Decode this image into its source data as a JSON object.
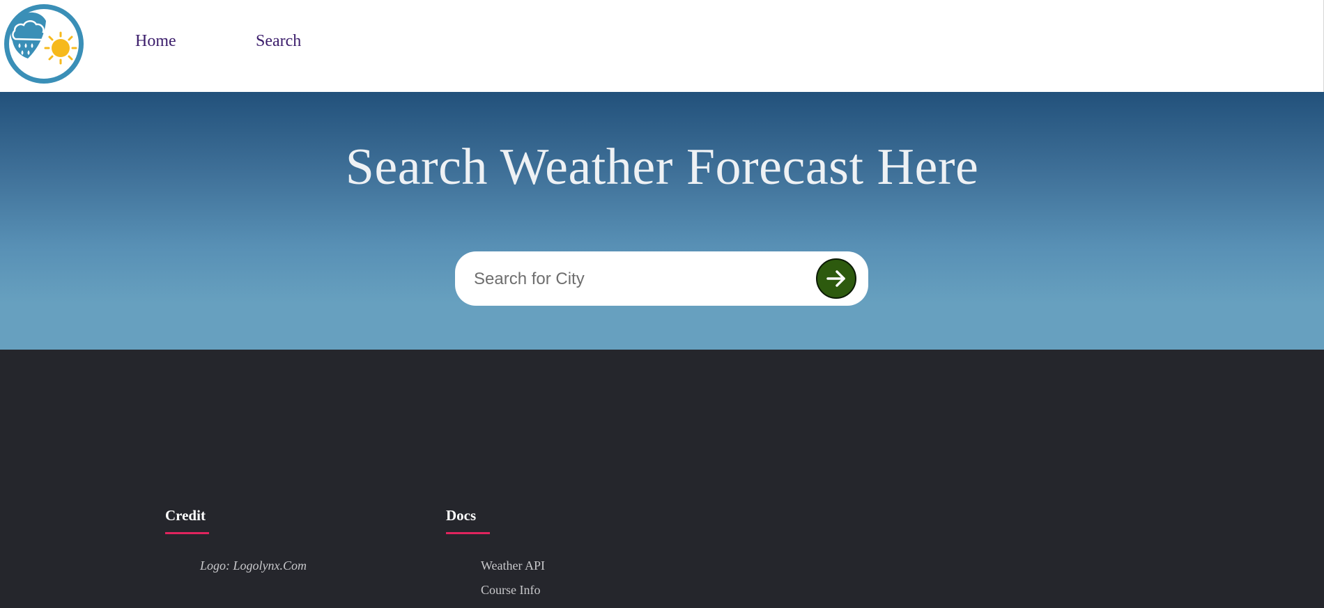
{
  "nav": {
    "logo_alt": "weather logo",
    "links": [
      {
        "label": "Home"
      },
      {
        "label": "Search"
      }
    ]
  },
  "hero": {
    "title": "Search Weather Forecast Here",
    "search": {
      "placeholder": "Search for City",
      "value": "",
      "button_icon": "arrow-right-icon"
    }
  },
  "footer": {
    "credit": {
      "heading": "Credit",
      "items": [
        "Logo: Logolynx.Com"
      ]
    },
    "docs": {
      "heading": "Docs",
      "items": [
        "Weather API",
        "Course Info"
      ]
    }
  },
  "colors": {
    "nav_link": "#3b1d6b",
    "hero_top": "#22517b",
    "hero_bottom": "#67a0bf",
    "search_button": "#2d5a0e",
    "footer_bg": "#25262c",
    "footer_accent": "#e0245e",
    "logo_circle": "#3a8fb7",
    "sun": "#f6b91c"
  }
}
